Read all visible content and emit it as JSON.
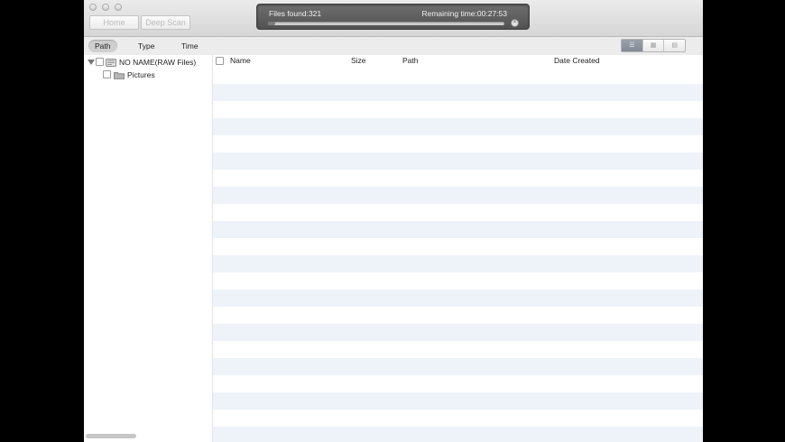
{
  "toolbar": {
    "home_label": "Home",
    "deep_scan_label": "Deep Scan"
  },
  "scan": {
    "files_found_label": "Files found:321",
    "remaining_label": "Remaining time:00:27:53",
    "progress_fraction": 0.03,
    "stop_glyph": "×"
  },
  "view_tabs": [
    {
      "label": "Path",
      "active": true
    },
    {
      "label": "Type",
      "active": false
    },
    {
      "label": "Time",
      "active": false
    }
  ],
  "view_modes": [
    {
      "icon": "list-view-icon",
      "glyph": "☰",
      "active": true
    },
    {
      "icon": "grid-view-icon",
      "glyph": "▦",
      "active": false
    },
    {
      "icon": "filmstrip-view-icon",
      "glyph": "▤",
      "active": false
    }
  ],
  "tree": {
    "root_label": "NO NAME(RAW Files)",
    "child_label": "Pictures"
  },
  "columns": {
    "name": "Name",
    "size": "Size",
    "path": "Path",
    "date_created": "Date Created"
  },
  "colors": {
    "row_stripe": "#eef3f9",
    "row_plain": "#ffffff",
    "folder": "#a9a9a9"
  }
}
